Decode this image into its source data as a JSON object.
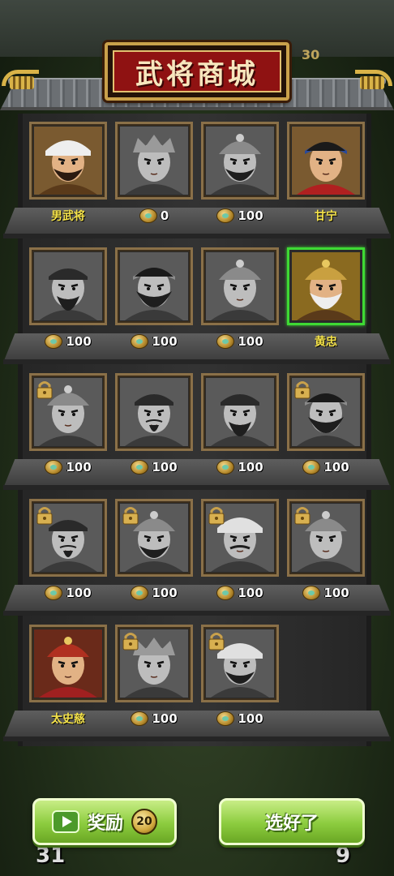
{
  "title": "武将商城",
  "background": {
    "left_count": "31",
    "right_count": "9",
    "top_num": "30"
  },
  "colors": {
    "selected_border": "#3ed934",
    "name_text": "#f5e34a",
    "button_green": "#8ccc3e"
  },
  "rows": [
    {
      "slots": [
        {
          "name": "男武将",
          "locked": false,
          "selected": false,
          "tone": "color",
          "look": "fur-hat-beard"
        },
        {
          "price": "0",
          "locked": false,
          "selected": false,
          "tone": "gray",
          "look": "woman-headdress"
        },
        {
          "price": "100",
          "locked": false,
          "selected": false,
          "tone": "gray",
          "look": "helmet-beard"
        },
        {
          "name": "甘宁",
          "locked": false,
          "selected": false,
          "tone": "color",
          "look": "headband-young"
        }
      ]
    },
    {
      "slots": [
        {
          "price": "100",
          "locked": false,
          "selected": false,
          "tone": "gray",
          "look": "long-beard"
        },
        {
          "price": "100",
          "locked": false,
          "selected": false,
          "tone": "gray",
          "look": "wild-beard"
        },
        {
          "price": "100",
          "locked": false,
          "selected": false,
          "tone": "gray",
          "look": "young-helmet"
        },
        {
          "name": "黄忠",
          "locked": false,
          "selected": true,
          "tone": "color",
          "look": "old-general"
        }
      ]
    },
    {
      "slots": [
        {
          "price": "100",
          "locked": true,
          "selected": false,
          "tone": "gray",
          "look": "young-helmet"
        },
        {
          "price": "100",
          "locked": false,
          "selected": false,
          "tone": "gray",
          "look": "scholar"
        },
        {
          "price": "100",
          "locked": false,
          "selected": false,
          "tone": "gray",
          "look": "long-beard"
        },
        {
          "price": "100",
          "locked": true,
          "selected": false,
          "tone": "gray",
          "look": "wild-beard"
        }
      ]
    },
    {
      "slots": [
        {
          "price": "100",
          "locked": true,
          "selected": false,
          "tone": "gray",
          "look": "scholar"
        },
        {
          "price": "100",
          "locked": true,
          "selected": false,
          "tone": "gray",
          "look": "helmet-beard"
        },
        {
          "price": "100",
          "locked": true,
          "selected": false,
          "tone": "gray",
          "look": "moustache-hat"
        },
        {
          "price": "100",
          "locked": true,
          "selected": false,
          "tone": "gray",
          "look": "young-helmet"
        }
      ]
    },
    {
      "slots": [
        {
          "name": "太史慈",
          "locked": false,
          "selected": false,
          "tone": "color",
          "look": "red-helmet"
        },
        {
          "price": "100",
          "locked": true,
          "selected": false,
          "tone": "gray",
          "look": "woman-headdress"
        },
        {
          "price": "100",
          "locked": true,
          "selected": false,
          "tone": "gray",
          "look": "fur-hat-beard"
        }
      ]
    }
  ],
  "buttons": {
    "reward": {
      "label": "奖励",
      "count": "20",
      "icon": "video-play-icon"
    },
    "confirm": {
      "label": "选好了"
    }
  }
}
